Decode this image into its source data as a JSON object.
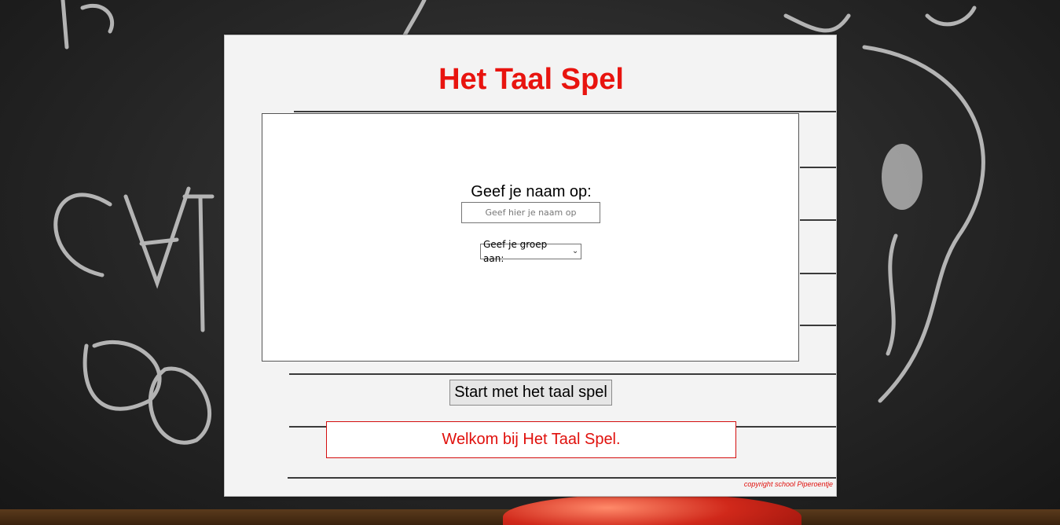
{
  "page": {
    "title": "Het Taal Spel"
  },
  "form": {
    "name_label": "Geef je naam op:",
    "name_placeholder": "Geef hier je naam op",
    "name_value": "",
    "group_select_label": "Geef je groep aan:"
  },
  "actions": {
    "start_label": "Start met het taal spel"
  },
  "message": {
    "text": "Welkom bij Het Taal Spel."
  },
  "footer": {
    "copyright": "copyright school Piperoentje"
  },
  "icons": {
    "select_chevron": "chevron-down-icon"
  },
  "colors": {
    "accent_red": "#e8140f",
    "paper": "#f3f3f3",
    "chalkboard": "#262626"
  }
}
